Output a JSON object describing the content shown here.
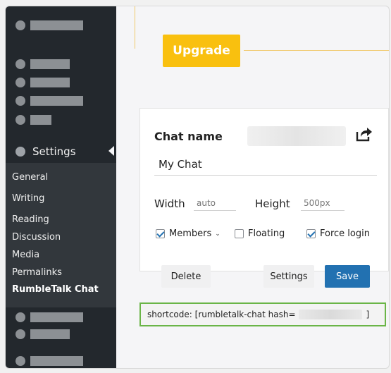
{
  "sidebar": {
    "settings_label": "Settings",
    "submenu": [
      {
        "label": "General"
      },
      {
        "label": "Writing"
      },
      {
        "label": "Reading"
      },
      {
        "label": "Discussion"
      },
      {
        "label": "Media"
      },
      {
        "label": "Permalinks"
      },
      {
        "label": "RumbleTalk Chat"
      }
    ]
  },
  "main": {
    "upgrade_label": "Upgrade",
    "chat_name_label": "Chat name",
    "chat_name_value": "My Chat",
    "width_label": "Width",
    "width_placeholder": "auto",
    "height_label": "Height",
    "height_placeholder": "500px",
    "options": {
      "members_label": "Members",
      "members_checked": true,
      "floating_label": "Floating",
      "floating_checked": false,
      "force_login_label": "Force login",
      "force_login_checked": true
    },
    "buttons": {
      "delete": "Delete",
      "settings": "Settings",
      "save": "Save"
    },
    "shortcode_prefix": "shortcode: [rumbletalk-chat hash=",
    "shortcode_suffix": "]"
  },
  "colors": {
    "sidebar_bg": "#23282d",
    "submenu_bg": "#32373c",
    "upgrade_yellow": "#f9c00f",
    "save_blue": "#2271b1",
    "shortcode_border": "#6ab547"
  }
}
